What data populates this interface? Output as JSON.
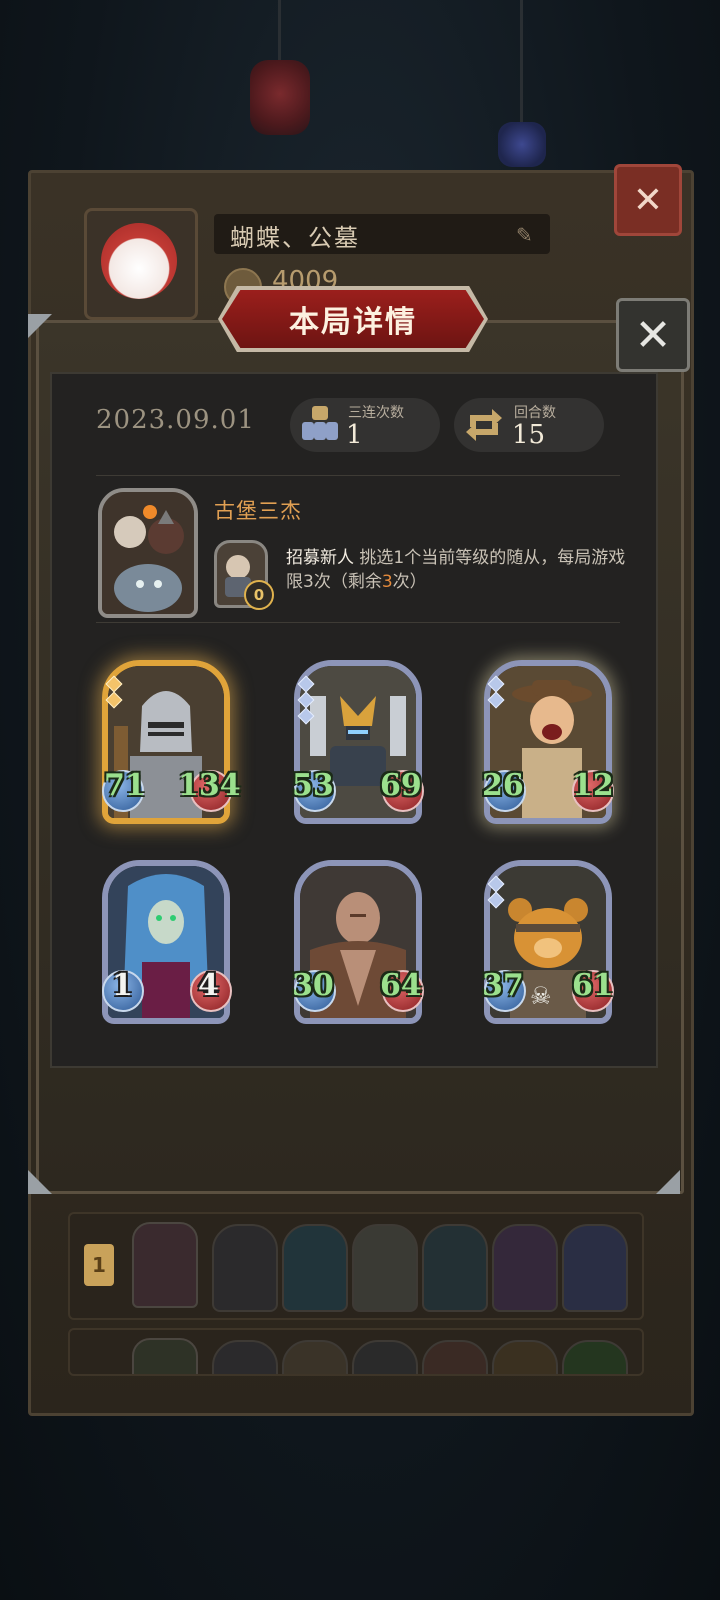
{
  "background": {
    "profile_name": "蝴蝶、公墓",
    "profile_score": "4009",
    "ranking_rows": [
      {
        "rank": "1"
      },
      {
        "rank": ""
      }
    ]
  },
  "modal": {
    "title": "本局详情",
    "date": "2023.09.01",
    "stats": [
      {
        "label": "三连次数",
        "value": "1",
        "icon": "triple-icon"
      },
      {
        "label": "回合数",
        "value": "15",
        "icon": "rounds-icon"
      }
    ],
    "hero": {
      "name": "古堡三杰",
      "skill_cost": "0",
      "skill_name": "招募新人",
      "skill_text_1": " 挑选1个当前等级的随从，每局游戏限3次（剩余",
      "skill_remaining": "3",
      "skill_text_2": "次）"
    },
    "minions": [
      {
        "attack": "71",
        "health": "134",
        "golden": true,
        "art": "knight"
      },
      {
        "attack": "53",
        "health": "69",
        "golden": false,
        "art": "robot"
      },
      {
        "attack": "26",
        "health": "12",
        "golden": false,
        "art": "adventurer"
      },
      {
        "attack": "1",
        "health": "4",
        "golden": false,
        "art": "siren"
      },
      {
        "attack": "30",
        "health": "64",
        "golden": false,
        "art": "brute"
      },
      {
        "attack": "37",
        "health": "61",
        "golden": false,
        "art": "bear"
      }
    ]
  },
  "colors": {
    "accent_red": "#9b1f1c",
    "hero_name": "#e1a053",
    "attack_green": "#9be08d",
    "highlight_orange": "#e38a3c"
  }
}
